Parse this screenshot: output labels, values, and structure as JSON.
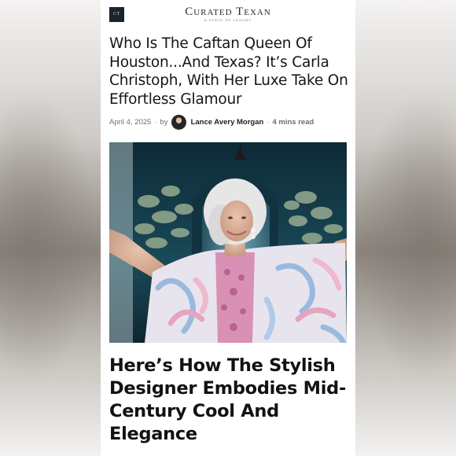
{
  "site": {
    "logo_mark": "CT",
    "brand_name": "Curated Texan",
    "tagline": "A STATE OF LUXURY"
  },
  "article": {
    "title": "Who Is The Caftan Queen Of Houston...And Texas? It’s Carla Christoph, With Her Luxe Take On Effortless Glamour",
    "date": "April 4, 2025",
    "by": "by",
    "author": "Lance Avery Morgan",
    "read_time": "4 mins read",
    "subtitle": "Here’s How The Stylish Designer Embodies Mid-Century Cool And Elegance"
  },
  "colors": {
    "logo_bg": "#1d2230",
    "title_text": "#161616",
    "meta_text": "#6f6f6f",
    "photo_background": "#143845"
  },
  "icons": {
    "author_avatar": "person-portrait-avatar",
    "hero": "woman-in-pink-blue-caftan-photo"
  }
}
